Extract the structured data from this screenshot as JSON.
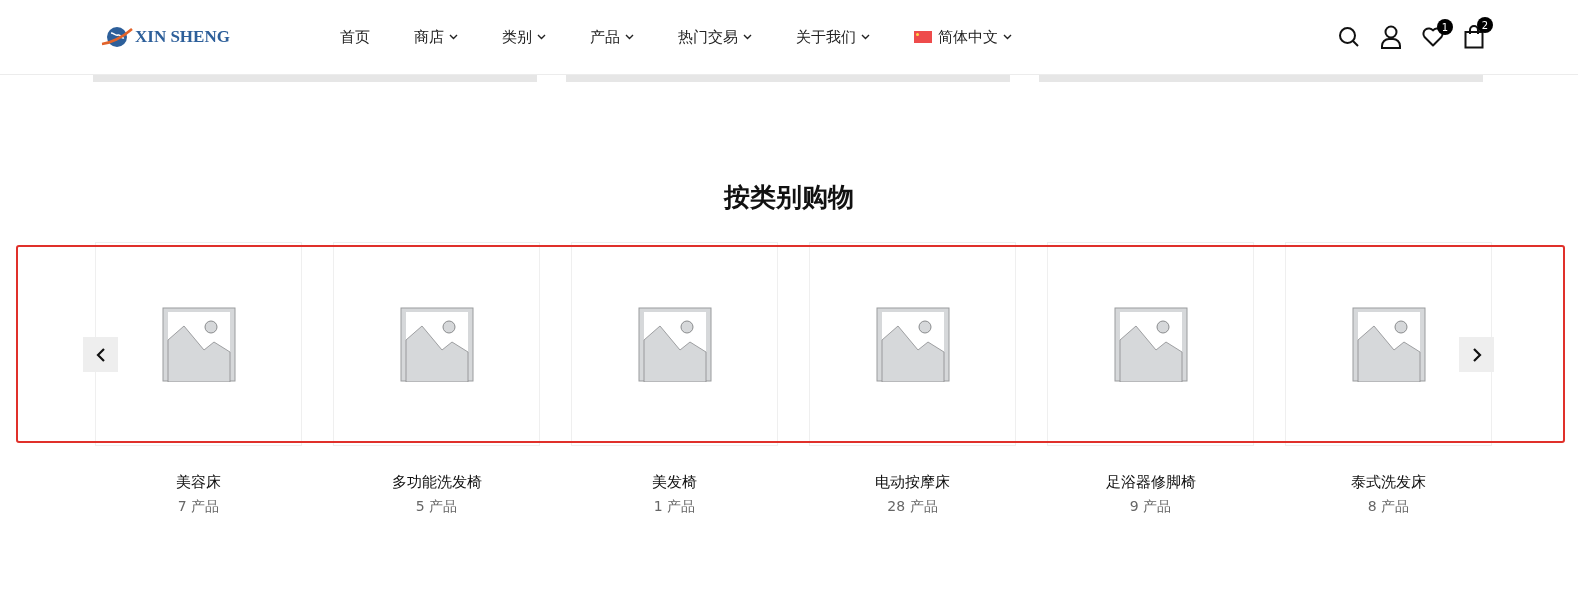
{
  "header": {
    "logo_text": "XIN SHENG",
    "nav": [
      {
        "label": "首页",
        "dropdown": false,
        "kind": "link"
      },
      {
        "label": "商店",
        "dropdown": true,
        "kind": "link"
      },
      {
        "label": "类别",
        "dropdown": true,
        "kind": "link"
      },
      {
        "label": "产品",
        "dropdown": true,
        "kind": "link"
      },
      {
        "label": "热门交易",
        "dropdown": true,
        "kind": "link"
      },
      {
        "label": "关于我们",
        "dropdown": true,
        "kind": "link"
      },
      {
        "label": "简体中文",
        "dropdown": true,
        "kind": "language"
      }
    ],
    "icons": [
      {
        "kind": "search"
      },
      {
        "kind": "account"
      },
      {
        "kind": "wishlist",
        "badge": "1"
      },
      {
        "kind": "cart",
        "badge": "2"
      }
    ]
  },
  "section": {
    "title": "按类别购物",
    "highlighted": true,
    "categories": [
      {
        "name": "美容床",
        "count": "7 产品"
      },
      {
        "name": "多功能洗发椅",
        "count": "5 产品"
      },
      {
        "name": "美发椅",
        "count": "1 产品"
      },
      {
        "name": "电动按摩床",
        "count": "28 产品"
      },
      {
        "name": "足浴器修脚椅",
        "count": "9 产品"
      },
      {
        "name": "泰式洗发床",
        "count": "8 产品"
      }
    ]
  }
}
